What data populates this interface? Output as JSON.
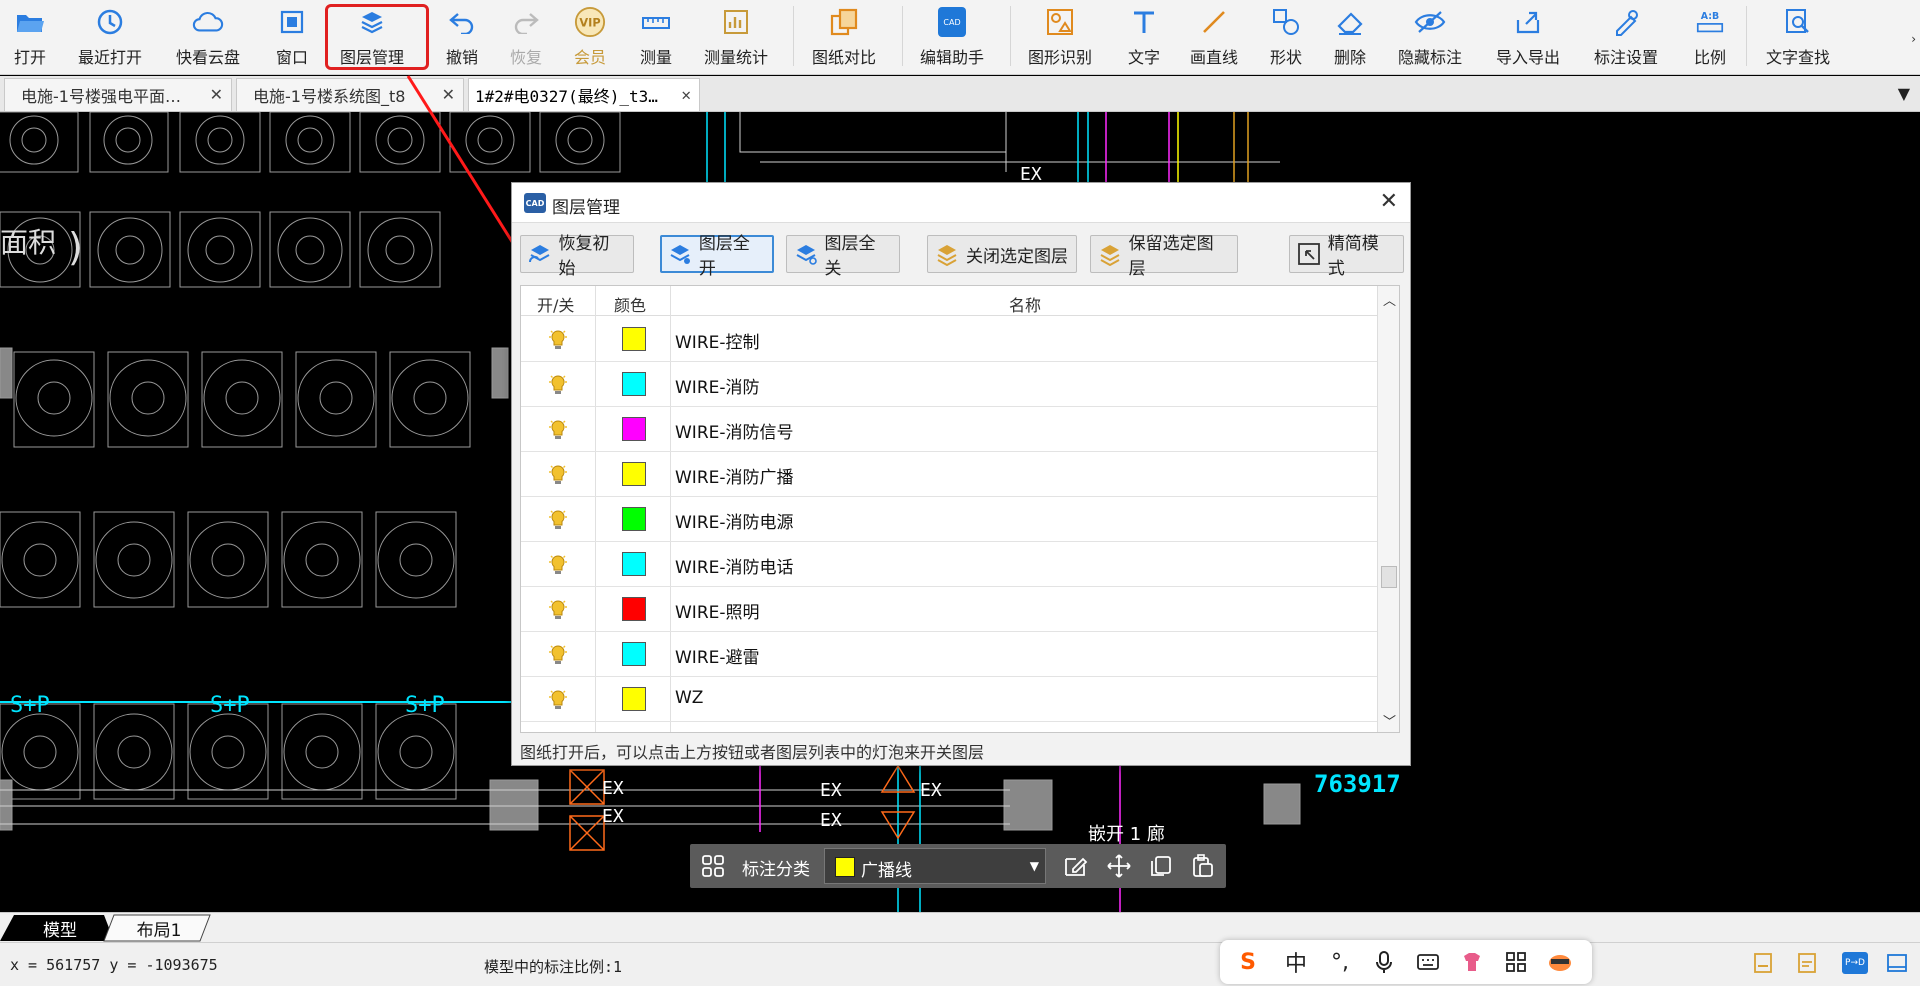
{
  "toolbar": {
    "items": [
      {
        "label": "打开",
        "icon": "folder-open-icon"
      },
      {
        "label": "最近打开",
        "icon": "clock-icon"
      },
      {
        "label": "快看云盘",
        "icon": "cloud-icon"
      },
      {
        "label": "窗口",
        "icon": "window-icon"
      },
      {
        "label": "图层管理",
        "icon": "layers-icon"
      },
      {
        "label": "撤销",
        "icon": "undo-icon"
      },
      {
        "label": "恢复",
        "icon": "redo-icon"
      },
      {
        "label": "会员",
        "icon": "vip-icon",
        "badge": "VIP"
      },
      {
        "label": "测量",
        "icon": "ruler-icon"
      },
      {
        "label": "测量统计",
        "icon": "measure-stats-icon"
      },
      {
        "label": "图纸对比",
        "icon": "compare-icon"
      },
      {
        "label": "编辑助手",
        "icon": "edit-assistant-icon"
      },
      {
        "label": "图形识别",
        "icon": "shape-recognition-icon"
      },
      {
        "label": "文字",
        "icon": "text-icon"
      },
      {
        "label": "画直线",
        "icon": "line-icon"
      },
      {
        "label": "形状",
        "icon": "shape-icon"
      },
      {
        "label": "删除",
        "icon": "eraser-icon"
      },
      {
        "label": "隐藏标注",
        "icon": "eye-hide-icon"
      },
      {
        "label": "导入导出",
        "icon": "import-export-icon"
      },
      {
        "label": "标注设置",
        "icon": "annotation-settings-icon"
      },
      {
        "label": "比例",
        "icon": "scale-icon"
      },
      {
        "label": "文字查找",
        "icon": "text-search-icon"
      }
    ]
  },
  "tabs": [
    {
      "title": "电施-1号楼强电平面…",
      "close": "✕"
    },
    {
      "title": "电施-1号楼系统图_t8",
      "close": "✕"
    },
    {
      "title": "1#2#电0327(最终)_t3…",
      "close": "✕"
    }
  ],
  "tab_menu": "▼",
  "canvas": {
    "labels": [
      "面积",
      ")",
      "763917",
      "EX",
      "S+P",
      "嵌开 1 廊"
    ]
  },
  "dialog": {
    "title": "图层管理",
    "app_icon": "CAD",
    "close": "✕",
    "buttons": [
      "恢复初始",
      "图层全开",
      "图层全关",
      "关闭选定图层",
      "保留选定图层",
      "精简模式"
    ],
    "columns": {
      "toggle": "开/关",
      "color": "颜色",
      "name": "名称"
    },
    "layers": [
      {
        "name": "WIRE-控制",
        "color": "#ffff00",
        "on": true
      },
      {
        "name": "WIRE-消防",
        "color": "#00ffff",
        "on": true
      },
      {
        "name": "WIRE-消防信号",
        "color": "#ff00ff",
        "on": true
      },
      {
        "name": "WIRE-消防广播",
        "color": "#ffff00",
        "on": true
      },
      {
        "name": "WIRE-消防电源",
        "color": "#00ff00",
        "on": true
      },
      {
        "name": "WIRE-消防电话",
        "color": "#00ffff",
        "on": true
      },
      {
        "name": "WIRE-照明",
        "color": "#ff0000",
        "on": true
      },
      {
        "name": "WIRE-避雷",
        "color": "#00ffff",
        "on": true
      },
      {
        "name": "WZ",
        "color": "#ffff00",
        "on": true
      }
    ],
    "footer": "图纸打开后，可以点击上方按钮或者图层列表中的灯泡来开关图层"
  },
  "annotation_bar": {
    "label": "标注分类",
    "selected": "广播线",
    "selected_color": "#ffff00"
  },
  "layout_tabs": [
    "模型",
    "布局1"
  ],
  "status": {
    "coords": "x = 561757 y = -1093675",
    "scale": "模型中的标注比例:1"
  },
  "ime": {
    "lang": "中"
  },
  "colors": {
    "highlight": "#e02020",
    "accent": "#3c8ad6"
  }
}
